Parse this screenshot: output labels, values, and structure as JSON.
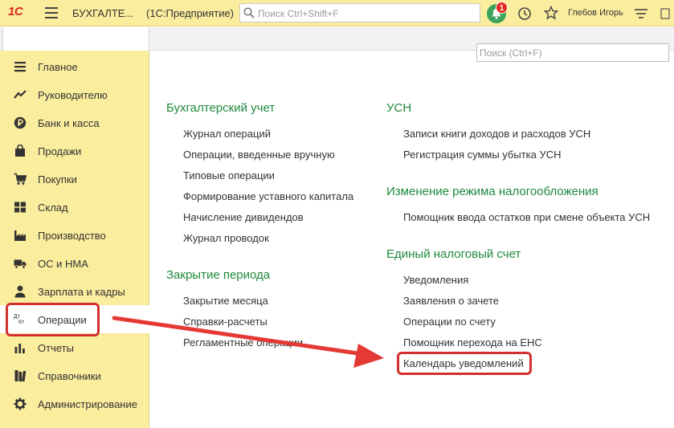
{
  "topbar": {
    "logo": "1С",
    "title": "БУХГАЛТЕ...",
    "platform": "(1С:Предприятие)",
    "search_placeholder": "Поиск Ctrl+Shift+F",
    "notifications_count": "1",
    "user": "Глебов Игорь"
  },
  "sidebar": {
    "items": [
      {
        "label": "Главное",
        "icon": "menu-lines-icon"
      },
      {
        "label": "Руководителю",
        "icon": "trend-icon"
      },
      {
        "label": "Банк и касса",
        "icon": "ruble-coin-icon"
      },
      {
        "label": "Продажи",
        "icon": "shopping-bag-icon"
      },
      {
        "label": "Покупки",
        "icon": "cart-icon"
      },
      {
        "label": "Склад",
        "icon": "warehouse-grid-icon"
      },
      {
        "label": "Производство",
        "icon": "factory-icon"
      },
      {
        "label": "ОС и НМА",
        "icon": "truck-icon"
      },
      {
        "label": "Зарплата и кадры",
        "icon": "person-icon"
      },
      {
        "label": "Операции",
        "icon": "debit-credit-icon"
      },
      {
        "label": "Отчеты",
        "icon": "bar-chart-icon"
      },
      {
        "label": "Справочники",
        "icon": "books-icon"
      },
      {
        "label": "Администрирование",
        "icon": "gear-icon"
      }
    ],
    "active_index": 9,
    "ops_icon_text_top": "Дт",
    "ops_icon_text_bottom": "Кт"
  },
  "main": {
    "search_placeholder": "Поиск (Ctrl+F)",
    "sections_left": [
      {
        "title": "Бухгалтерский учет",
        "links": [
          "Журнал операций",
          "Операции, введенные вручную",
          "Типовые операции",
          "Формирование уставного капитала",
          "Начисление дивидендов",
          "Журнал проводок"
        ]
      },
      {
        "title": "Закрытие периода",
        "links": [
          "Закрытие месяца",
          "Справки-расчеты",
          "Регламентные операции"
        ]
      }
    ],
    "sections_right": [
      {
        "title": "УСН",
        "links": [
          "Записи книги доходов и расходов УСН",
          "Регистрация суммы убытка УСН"
        ]
      },
      {
        "title": "Изменение режима налогообложения",
        "links": [
          "Помощник ввода остатков при смене объекта УСН"
        ]
      },
      {
        "title": "Единый налоговый счет",
        "links": [
          "Уведомления",
          "Заявления о зачете",
          "Операции по счету",
          "Помощник перехода на ЕНС",
          "Календарь уведомлений"
        ]
      }
    ]
  },
  "colors": {
    "sidebar_bg": "#fbed9e",
    "section_title": "#1e8a3c",
    "highlight": "#d32f2f",
    "notification_green": "#3aa35a",
    "badge_red": "#e3261d"
  }
}
